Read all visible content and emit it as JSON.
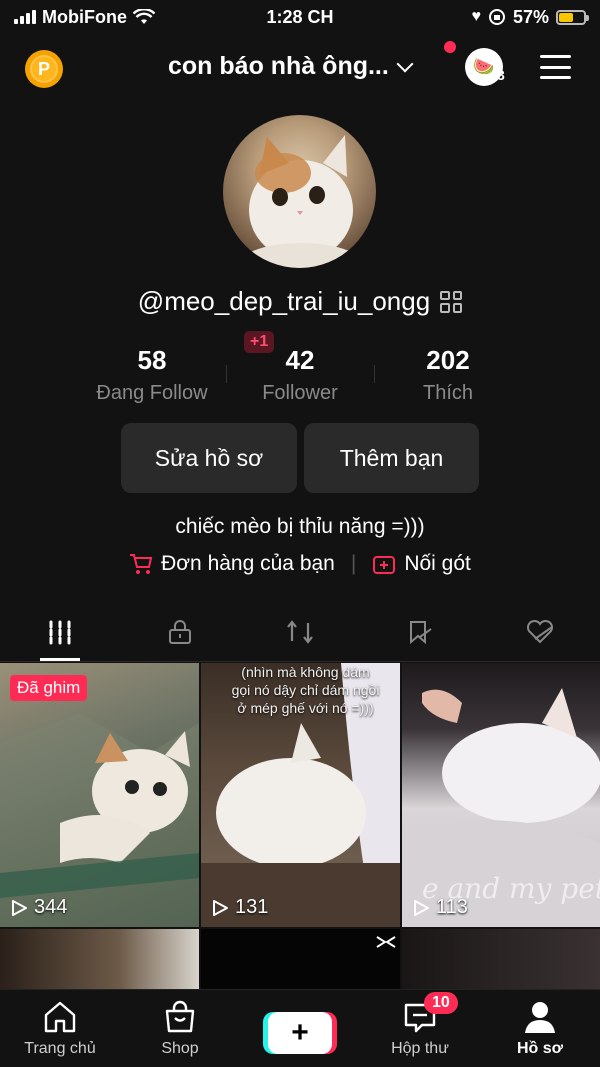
{
  "status_bar": {
    "carrier": "MobiFone",
    "time": "1:28 CH",
    "battery": "57%",
    "battery_level": 0.57
  },
  "header": {
    "title": "con báo nhà ông...",
    "story_count": "3",
    "story_emoji": "🍉",
    "coin_letter": "P"
  },
  "profile": {
    "username": "@meo_dep_trai_iu_ongg",
    "stats": [
      {
        "num": "58",
        "label": "Đang Follow"
      },
      {
        "num": "42",
        "label": "Follower"
      },
      {
        "num": "202",
        "label": "Thích"
      }
    ],
    "new_follower_badge": "+1",
    "buttons": {
      "edit": "Sửa hồ sơ",
      "add_friend": "Thêm bạn"
    },
    "bio": "chiếc mèo bị thỉu năng =)))",
    "links": {
      "orders": "Đơn hàng của bạn",
      "separator": "|",
      "continue": "Nối gót"
    }
  },
  "videos": [
    {
      "views": "344",
      "pinned_label": "Đã ghim"
    },
    {
      "views": "131",
      "caption": "(nhìn mà không dám gọi nó dậy chỉ dám ngồi ở mép ghế với nó =)))"
    },
    {
      "views": "113",
      "watermark": "e and my pet"
    }
  ],
  "bottom_nav": {
    "home": "Trang chủ",
    "shop": "Shop",
    "create": "+",
    "inbox": "Hộp thư",
    "inbox_badge": "10",
    "profile": "Hồ sơ"
  },
  "colors": {
    "accent": "#fe2c55",
    "cyan": "#25f4ee",
    "background": "#121212",
    "coin": "#f5a300"
  }
}
